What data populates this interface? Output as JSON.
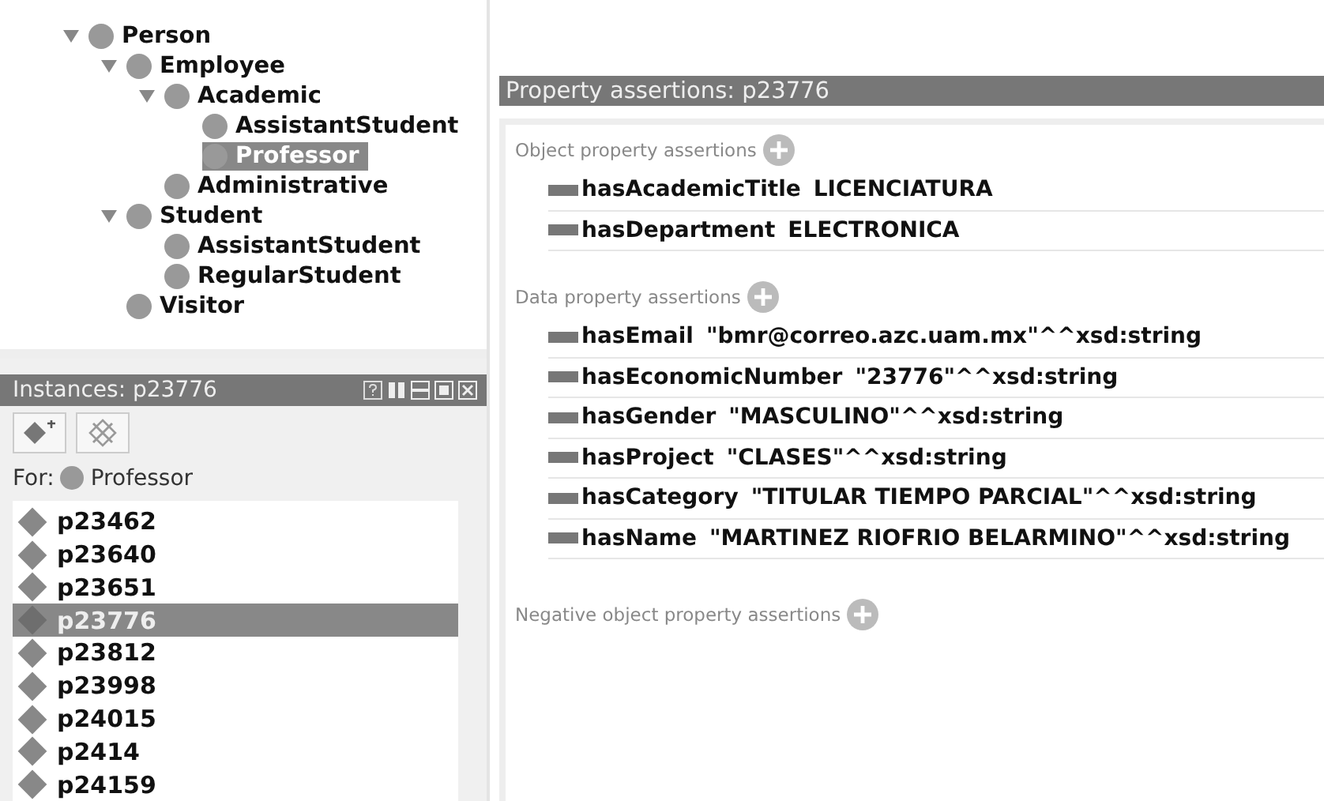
{
  "class_tree": [
    {
      "label": "Person",
      "expanded": true,
      "selected": false,
      "children": [
        {
          "label": "Employee",
          "expanded": true,
          "selected": false,
          "children": [
            {
              "label": "Academic",
              "expanded": true,
              "selected": false,
              "children": [
                {
                  "label": "AssistantStudent",
                  "selected": false
                },
                {
                  "label": "Professor",
                  "selected": true
                }
              ]
            },
            {
              "label": "Administrative",
              "selected": false
            }
          ]
        },
        {
          "label": "Student",
          "expanded": true,
          "selected": false,
          "children": [
            {
              "label": "AssistantStudent",
              "selected": false
            },
            {
              "label": "RegularStudent",
              "selected": false
            }
          ]
        },
        {
          "label": "Visitor",
          "selected": false
        }
      ]
    }
  ],
  "instances_panel": {
    "title": "Instances: p23776",
    "for_label": "For:",
    "for_class": "Professor",
    "items": [
      {
        "label": "p23462",
        "selected": false
      },
      {
        "label": "p23640",
        "selected": false
      },
      {
        "label": "p23651",
        "selected": false
      },
      {
        "label": "p23776",
        "selected": true
      },
      {
        "label": "p23812",
        "selected": false
      },
      {
        "label": "p23998",
        "selected": false
      },
      {
        "label": "p24015",
        "selected": false
      },
      {
        "label": "p2414",
        "selected": false
      },
      {
        "label": "p24159",
        "selected": false
      }
    ]
  },
  "property_panel": {
    "title": "Property assertions: p23776",
    "sections": [
      {
        "heading": "Object property assertions",
        "rows": [
          {
            "property": "hasAcademicTitle",
            "value": "LICENCIATURA"
          },
          {
            "property": "hasDepartment",
            "value": "ELECTRONICA"
          }
        ]
      },
      {
        "heading": "Data property assertions",
        "rows": [
          {
            "property": "hasEmail",
            "value": "\"bmr@correo.azc.uam.mx\"^^xsd:string"
          },
          {
            "property": "hasEconomicNumber",
            "value": "\"23776\"^^xsd:string"
          },
          {
            "property": "hasGender",
            "value": "\"MASCULINO\"^^xsd:string"
          },
          {
            "property": "hasProject",
            "value": "\"CLASES\"^^xsd:string"
          },
          {
            "property": "hasCategory",
            "value": "\"TITULAR TIEMPO PARCIAL\"^^xsd:string"
          },
          {
            "property": "hasName",
            "value": "\"MARTINEZ RIOFRIO BELARMINO\"^^xsd:string"
          }
        ]
      },
      {
        "heading": "Negative object property assertions"
      }
    ]
  }
}
